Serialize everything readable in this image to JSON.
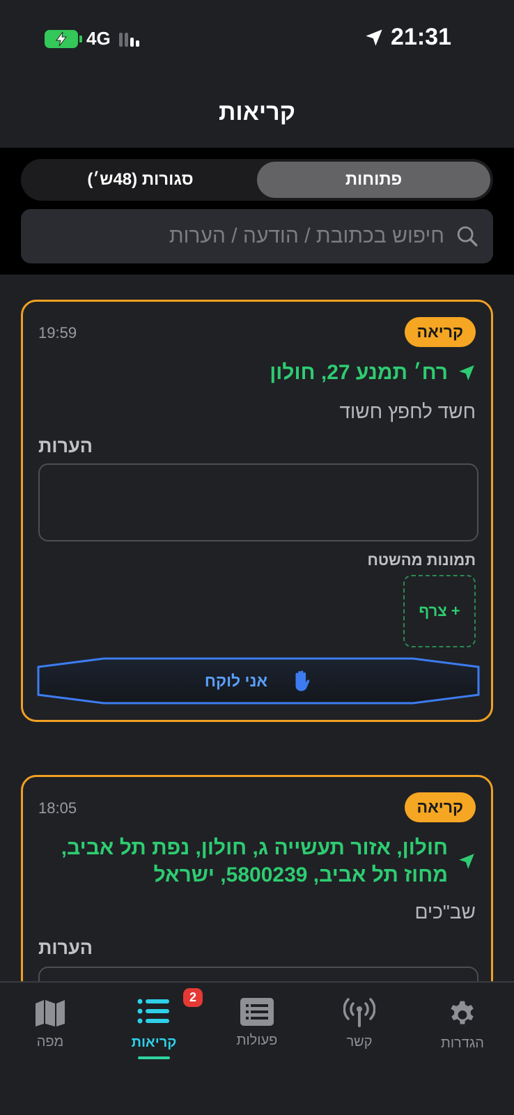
{
  "status_bar": {
    "network": "4G",
    "time": "21:31"
  },
  "header": {
    "title": "קריאות"
  },
  "segments": {
    "open": "פתוחות",
    "closed": "סגורות (48ש׳)"
  },
  "search": {
    "placeholder": "חיפוש בכתובת / הודעה / הערות"
  },
  "calls": [
    {
      "badge": "קריאה",
      "time": "19:59",
      "address": "רח׳ תמנע 27, חולון",
      "description": "חשד לחפץ חשוד",
      "notes_label": "הערות",
      "photos_label": "תמונות מהשטח",
      "attach_label": "+ צרף",
      "take_label": "אני לוקח"
    },
    {
      "badge": "קריאה",
      "time": "18:05",
      "address": "חולון, אזור תעשייה ג, חולון, נפת תל אביב, מחוז תל אביב, 5800239, ישראל",
      "description": "שב\"כים",
      "notes_label": "הערות"
    }
  ],
  "tabbar": {
    "map": "מפה",
    "calls": "קריאות",
    "calls_badge": "2",
    "actions": "פעולות",
    "comms": "קשר",
    "settings": "הגדרות"
  },
  "colors": {
    "accent_orange": "#f0a023",
    "address_green": "#2ecc71",
    "active_tab": "#2fd0e8",
    "button_blue": "#3d7cf0"
  }
}
